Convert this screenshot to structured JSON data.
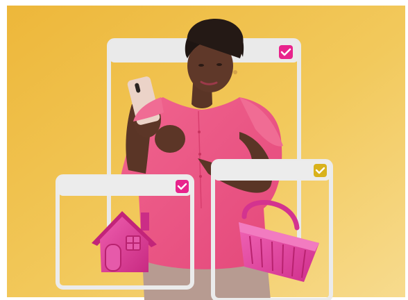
{
  "scene": {
    "description_visible_text": "",
    "colors": {
      "background_top": "#EDB93C",
      "background_bottom": "#F6D987",
      "window_frame": "#ECECEC",
      "window_bar": "#E4E4E4",
      "check_pink": "#E8238C",
      "check_yellow": "#D9B21C",
      "blouse": "#EE5A86",
      "skin": "#5A3526",
      "phone": "#EBD3C8",
      "house": "#E0459A",
      "basket": "#E64AA3",
      "pants": "#B59A90"
    },
    "icons": [
      "checkbox-checked-icon",
      "checkbox-checked-icon",
      "checkbox-checked-icon",
      "house-icon",
      "shopping-basket-icon"
    ]
  }
}
